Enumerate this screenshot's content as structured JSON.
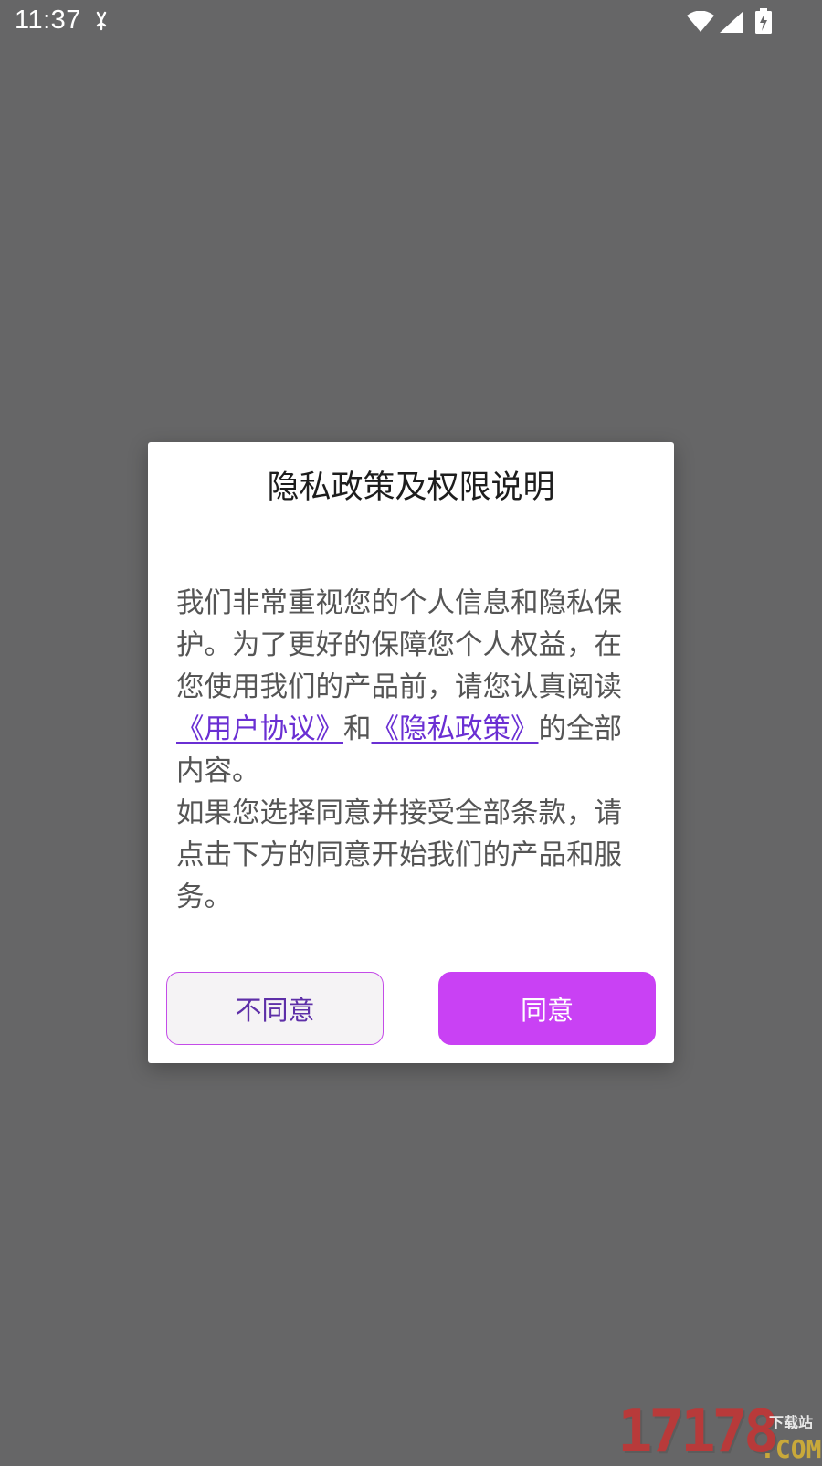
{
  "status_bar": {
    "time": "11:37",
    "icons": [
      "notification-icon",
      "wifi-icon",
      "signal-icon",
      "battery-charging-icon"
    ]
  },
  "dialog": {
    "title": "隐私政策及权限说明",
    "body": {
      "paragraph1_part1": "我们非常重视您的个人信息和隐私保护。为了更好的保障您个人权益，在您使用我们的产品前，请您认真阅读",
      "user_agreement_link": "《用户协议》",
      "connector": "和",
      "privacy_policy_link": "《隐私政策》",
      "paragraph1_part2": "的全部内容。",
      "paragraph2": "如果您选择同意并接受全部条款，请点击下方的同意开始我们的产品和服务。"
    },
    "buttons": {
      "disagree": "不同意",
      "agree": "同意"
    },
    "colors": {
      "accent": "#c941f4",
      "link": "#6a2fd3"
    }
  },
  "watermark": {
    "number": "17178",
    "sub": "下载站",
    "domain": ".COM"
  }
}
